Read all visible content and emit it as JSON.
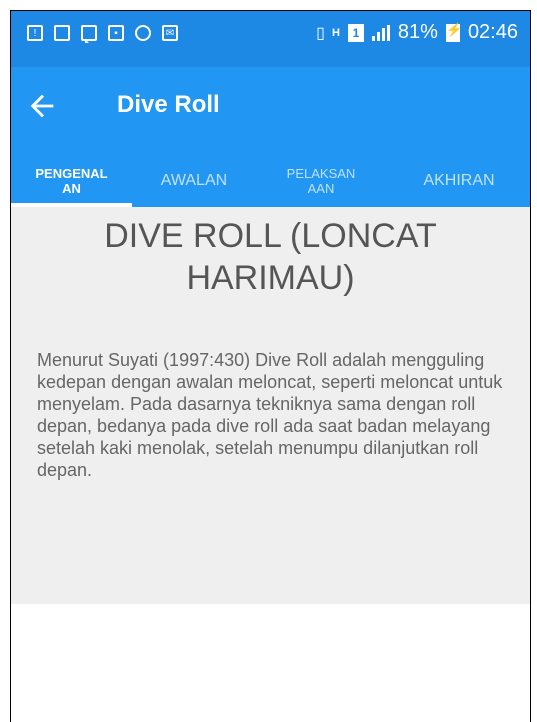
{
  "status_bar": {
    "battery_percent": "81%",
    "time": "02:46",
    "sim_label": "1",
    "network_label": "H",
    "icons": [
      "alert-icon",
      "sd-card-icon",
      "chat-icon",
      "image-icon",
      "messenger-icon",
      "email-icon",
      "vibrate-icon",
      "data-icon",
      "sim-icon",
      "signal-icon",
      "battery-icon"
    ]
  },
  "app_bar": {
    "title": "Dive Roll",
    "back_icon": "arrow-back-icon"
  },
  "tabs": [
    {
      "label_line1": "PENGENAL",
      "label_line2": "AN",
      "active": true
    },
    {
      "label": "AWALAN"
    },
    {
      "label_line1": "PELAKSAN",
      "label_line2": "AAN"
    },
    {
      "label": "AKHIRAN"
    }
  ],
  "content": {
    "heading_line1": "DIVE ROLL (LONCAT",
    "heading_line2": "HARIMAU)",
    "paragraph": "Menurut Suyati (1997:430) Dive Roll adalah mengguling kedepan dengan awalan meloncat, seperti meloncat untuk menyelam. Pada dasarnya tekniknya sama dengan roll depan, bedanya pada dive roll ada saat badan melayang setelah kaki menolak, setelah menumpu dilanjutkan roll depan."
  },
  "colors": {
    "status_bar": "#1e88e5",
    "app_bar": "#2196f3",
    "content_bg": "#efefef",
    "text": "#666666"
  }
}
